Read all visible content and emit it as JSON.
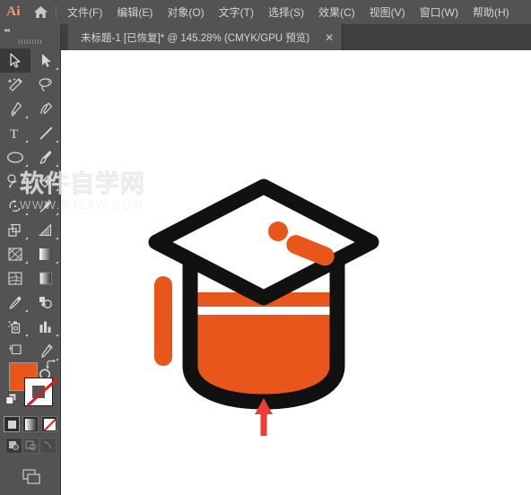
{
  "app": {
    "name": "Ai",
    "logo_label": "Ai",
    "home_icon": "home-icon"
  },
  "menubar": {
    "items": [
      {
        "label": "文件(F)",
        "name": "menu-file"
      },
      {
        "label": "编辑(E)",
        "name": "menu-edit"
      },
      {
        "label": "对象(O)",
        "name": "menu-object"
      },
      {
        "label": "文字(T)",
        "name": "menu-type"
      },
      {
        "label": "选择(S)",
        "name": "menu-select"
      },
      {
        "label": "效果(C)",
        "name": "menu-effect"
      },
      {
        "label": "视图(V)",
        "name": "menu-view"
      },
      {
        "label": "窗口(W)",
        "name": "menu-window"
      },
      {
        "label": "帮助(H)",
        "name": "menu-help"
      }
    ]
  },
  "tab": {
    "title": "未标题-1 [已恢复]* @ 145.28% (CMYK/GPU 预览)",
    "document_name": "未标题-1",
    "state": "[已恢复]",
    "modified": "*",
    "zoom": "145.28%",
    "color_mode": "CMYK/GPU 预览",
    "close_label": "✕"
  },
  "toolbar": {
    "collapse_label": "◂◂",
    "tools": [
      {
        "name": "selection-tool",
        "title": "选择工具",
        "active": true,
        "has_flyout": false
      },
      {
        "name": "direct-selection-tool",
        "title": "直接选择工具",
        "active": false,
        "has_flyout": true
      },
      {
        "name": "magic-wand-tool",
        "title": "魔棒工具",
        "active": false,
        "has_flyout": false
      },
      {
        "name": "lasso-tool",
        "title": "套索工具",
        "active": false,
        "has_flyout": false
      },
      {
        "name": "pen-tool",
        "title": "钢笔工具",
        "active": false,
        "has_flyout": true
      },
      {
        "name": "curvature-tool",
        "title": "曲率工具",
        "active": false,
        "has_flyout": false
      },
      {
        "name": "type-tool",
        "title": "文字工具",
        "active": false,
        "has_flyout": true
      },
      {
        "name": "line-segment-tool",
        "title": "直线段工具",
        "active": false,
        "has_flyout": true
      },
      {
        "name": "ellipse-tool",
        "title": "椭圆工具",
        "active": false,
        "has_flyout": true
      },
      {
        "name": "paintbrush-tool",
        "title": "画笔工具",
        "active": false,
        "has_flyout": true
      },
      {
        "name": "shaper-tool",
        "title": "Shaper 工具",
        "active": false,
        "has_flyout": true
      },
      {
        "name": "eraser-tool",
        "title": "橡皮擦工具",
        "active": false,
        "has_flyout": true
      },
      {
        "name": "rotate-tool",
        "title": "旋转工具",
        "active": false,
        "has_flyout": true
      },
      {
        "name": "scale-tool",
        "title": "比例缩放工具",
        "active": false,
        "has_flyout": true
      },
      {
        "name": "width-tool",
        "title": "宽度工具",
        "active": false,
        "has_flyout": true
      },
      {
        "name": "free-transform-tool",
        "title": "自由变换工具",
        "active": false,
        "has_flyout": true
      },
      {
        "name": "shape-builder-tool",
        "title": "形状生成器工具",
        "active": false,
        "has_flyout": true
      },
      {
        "name": "perspective-grid-tool",
        "title": "透视网格工具",
        "active": false,
        "has_flyout": true
      },
      {
        "name": "mesh-tool",
        "title": "网格工具",
        "active": false,
        "has_flyout": false
      },
      {
        "name": "gradient-tool",
        "title": "渐变工具",
        "active": false,
        "has_flyout": false
      },
      {
        "name": "eyedropper-tool",
        "title": "吸管工具",
        "active": false,
        "has_flyout": true
      },
      {
        "name": "blend-tool",
        "title": "混合工具",
        "active": false,
        "has_flyout": false
      },
      {
        "name": "symbol-sprayer-tool",
        "title": "符号喷枪工具",
        "active": false,
        "has_flyout": true
      },
      {
        "name": "column-graph-tool",
        "title": "柱形图工具",
        "active": false,
        "has_flyout": true
      },
      {
        "name": "artboard-tool",
        "title": "画板工具",
        "active": false,
        "has_flyout": false
      },
      {
        "name": "slice-tool",
        "title": "切片工具",
        "active": false,
        "has_flyout": true
      },
      {
        "name": "hand-tool",
        "title": "抓手工具",
        "active": false,
        "has_flyout": true
      },
      {
        "name": "zoom-tool",
        "title": "缩放工具",
        "active": false,
        "has_flyout": false
      }
    ],
    "fill_color": "#e8561b",
    "stroke_color": "#ffffff",
    "stroke_is_none": true,
    "fill_label": "填色",
    "stroke_label": "描边",
    "swap_label": "互换填色和描边",
    "default_label": "默认填色和描边",
    "paint_modes": [
      {
        "name": "mode-color",
        "label": "颜色",
        "selected": true
      },
      {
        "name": "mode-gradient",
        "label": "渐变",
        "selected": false
      },
      {
        "name": "mode-none",
        "label": "无",
        "selected": false
      }
    ],
    "draw_modes": [
      {
        "name": "draw-normal",
        "label": "正常绘图",
        "selected": true
      },
      {
        "name": "draw-behind",
        "label": "背面绘图",
        "selected": false
      },
      {
        "name": "draw-inside",
        "label": "内部绘图",
        "selected": false
      }
    ],
    "screen_mode_label": "更改屏幕模式"
  },
  "canvas": {
    "background": "#ffffff",
    "artwork_title": "毕业帽图标",
    "colors": {
      "black": "#111111",
      "orange": "#e8561b",
      "red_arrow": "#ee3b33",
      "white": "#ffffff"
    },
    "elements": [
      {
        "name": "cap-board",
        "shape": "diamond-outline",
        "color": "#111111"
      },
      {
        "name": "cap-base",
        "shape": "cylinder-outline",
        "color": "#111111"
      },
      {
        "name": "cap-base-fill",
        "shape": "orange-bands",
        "color": "#e8561b"
      },
      {
        "name": "tassel-dot",
        "shape": "circle",
        "color": "#e8561b"
      },
      {
        "name": "tassel-bar",
        "shape": "rounded-bar",
        "color": "#e8561b"
      },
      {
        "name": "side-bar",
        "shape": "rounded-bar",
        "color": "#e8561b"
      },
      {
        "name": "pointer-arrow",
        "shape": "arrow-up",
        "color": "#ee3b33"
      }
    ]
  },
  "watermark": {
    "chinese": "软件自学网",
    "url": "WWW.RJZXW.COM"
  }
}
